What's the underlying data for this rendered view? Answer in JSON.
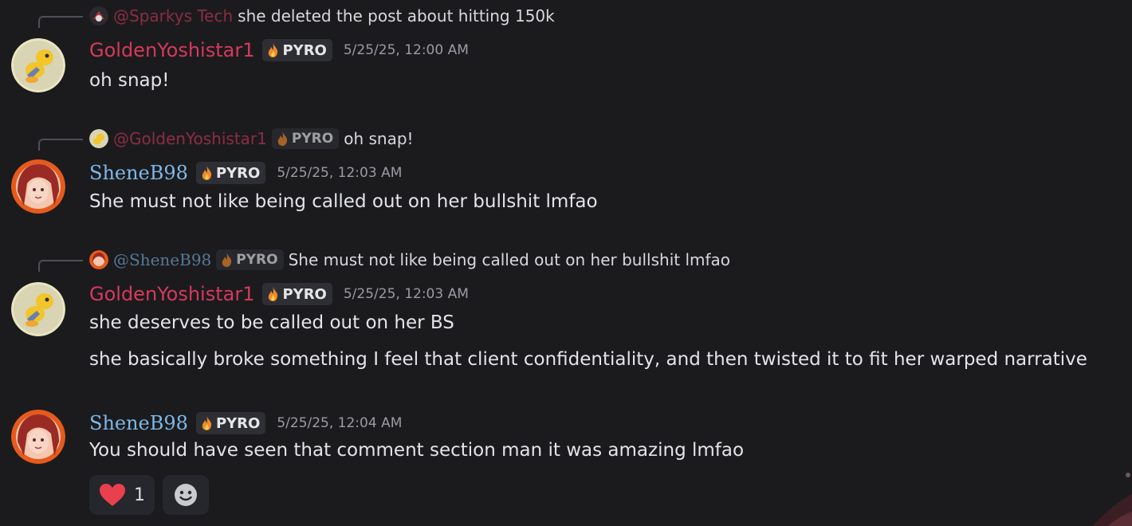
{
  "messages": [
    {
      "reply": {
        "name": "@Sparkys Tech",
        "text": "she deleted the post about hitting 150k"
      },
      "author": "GoldenYoshistar1",
      "badge": "PYRO",
      "timestamp": "5/25/25, 12:00 AM",
      "lines": [
        "oh snap!"
      ]
    },
    {
      "reply": {
        "name": "@GoldenYoshistar1",
        "badge": "PYRO",
        "text": "oh snap!"
      },
      "author": "SheneB98",
      "badge": "PYRO",
      "timestamp": "5/25/25, 12:03 AM",
      "lines": [
        "She must not like being called out on her bullshit lmfao"
      ]
    },
    {
      "reply": {
        "name": "@ShenеB98",
        "badge": "PYRO",
        "text": "She must not like being called out on her bullshit lmfao"
      },
      "author": "GoldenYoshistar1",
      "badge": "PYRO",
      "timestamp": "5/25/25, 12:03 AM",
      "lines": [
        "she deserves to be called out on her BS",
        "she basically broke something I feel that client confidentiality, and then twisted it to fit her warped narrative"
      ]
    },
    {
      "author": "ShenеB98",
      "badge": "PYRO",
      "timestamp": "5/25/25, 12:04 AM",
      "lines": [
        "You should have seen that comment section man it was amazing lmfao"
      ],
      "reactions": [
        {
          "emoji": "heart",
          "count": "1"
        }
      ]
    }
  ],
  "colors": {
    "background": "#1b1b1e",
    "yoshi_name": "#d6395b",
    "shene_name": "#7fb7e6",
    "badge_bg": "#2e2f35",
    "timestamp": "#9a9ba3",
    "heart": "#e8404e"
  }
}
